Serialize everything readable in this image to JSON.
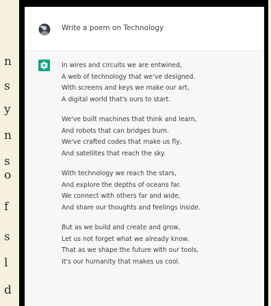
{
  "user_message": {
    "text": "Write a poem on Technology"
  },
  "assistant_message": {
    "stanzas": [
      {
        "lines": [
          "In wires and circuits we are entwined,",
          "A web of technology that we've designed.",
          "With screens and keys we make our art,",
          "A digital world that's ours to start."
        ]
      },
      {
        "lines": [
          "We've built machines that think and learn,",
          "And robots that can bridges burn.",
          "We've crafted codes that make us fly,",
          "And satellites that reach the sky."
        ]
      },
      {
        "lines": [
          "With technology we reach the stars,",
          "And explore the depths of oceans far.",
          "We connect with others far and wide,",
          "And share our thoughts and feelings inside."
        ]
      },
      {
        "lines": [
          "But as we build and create and grow,",
          "Let us not forget what we already know.",
          "That as we shape the future with our tools,",
          "It's our humanity that makes us cool."
        ]
      }
    ]
  },
  "page_edge_chars": [
    "n",
    "s",
    "y",
    "n",
    "s",
    "o",
    "f",
    "s",
    "l",
    "d"
  ],
  "colors": {
    "page_background": "#f6f0df",
    "frame": "#000000",
    "assistant_background": "#f7f7f8",
    "assistant_icon": "#10a37f",
    "text": "#3b3b44"
  },
  "icons": {
    "user_avatar": "user-avatar-icon",
    "assistant": "chatgpt-logo-icon"
  }
}
